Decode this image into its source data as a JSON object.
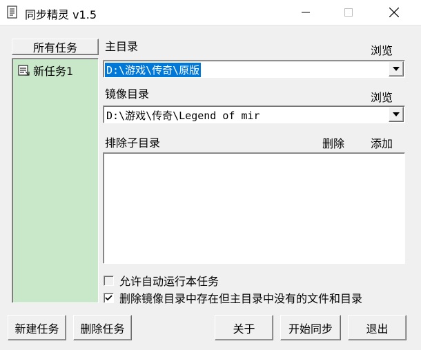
{
  "window": {
    "title": "同步精灵 v1.5"
  },
  "tasks": {
    "header": "所有任务",
    "items": [
      "新任务1"
    ]
  },
  "main_dir": {
    "label": "主目录",
    "browse": "浏览",
    "value": "D:\\游戏\\传奇\\原版"
  },
  "mirror_dir": {
    "label": "镜像目录",
    "browse": "浏览",
    "value": "D:\\游戏\\传奇\\Legend of mir"
  },
  "exclude": {
    "label": "排除子目录",
    "delete": "删除",
    "add": "添加"
  },
  "options": {
    "auto_run": {
      "label": "允许自动运行本任务",
      "checked": false
    },
    "delete_extra": {
      "label": "删除镜像目录中存在但主目录中没有的文件和目录",
      "checked": true
    }
  },
  "buttons": {
    "new_task": "新建任务",
    "delete_task": "删除任务",
    "about": "关于",
    "start_sync": "开始同步",
    "exit": "退出"
  },
  "colors": {
    "task_list_bg": "#c9e8c9",
    "selection": "#0078d7"
  }
}
